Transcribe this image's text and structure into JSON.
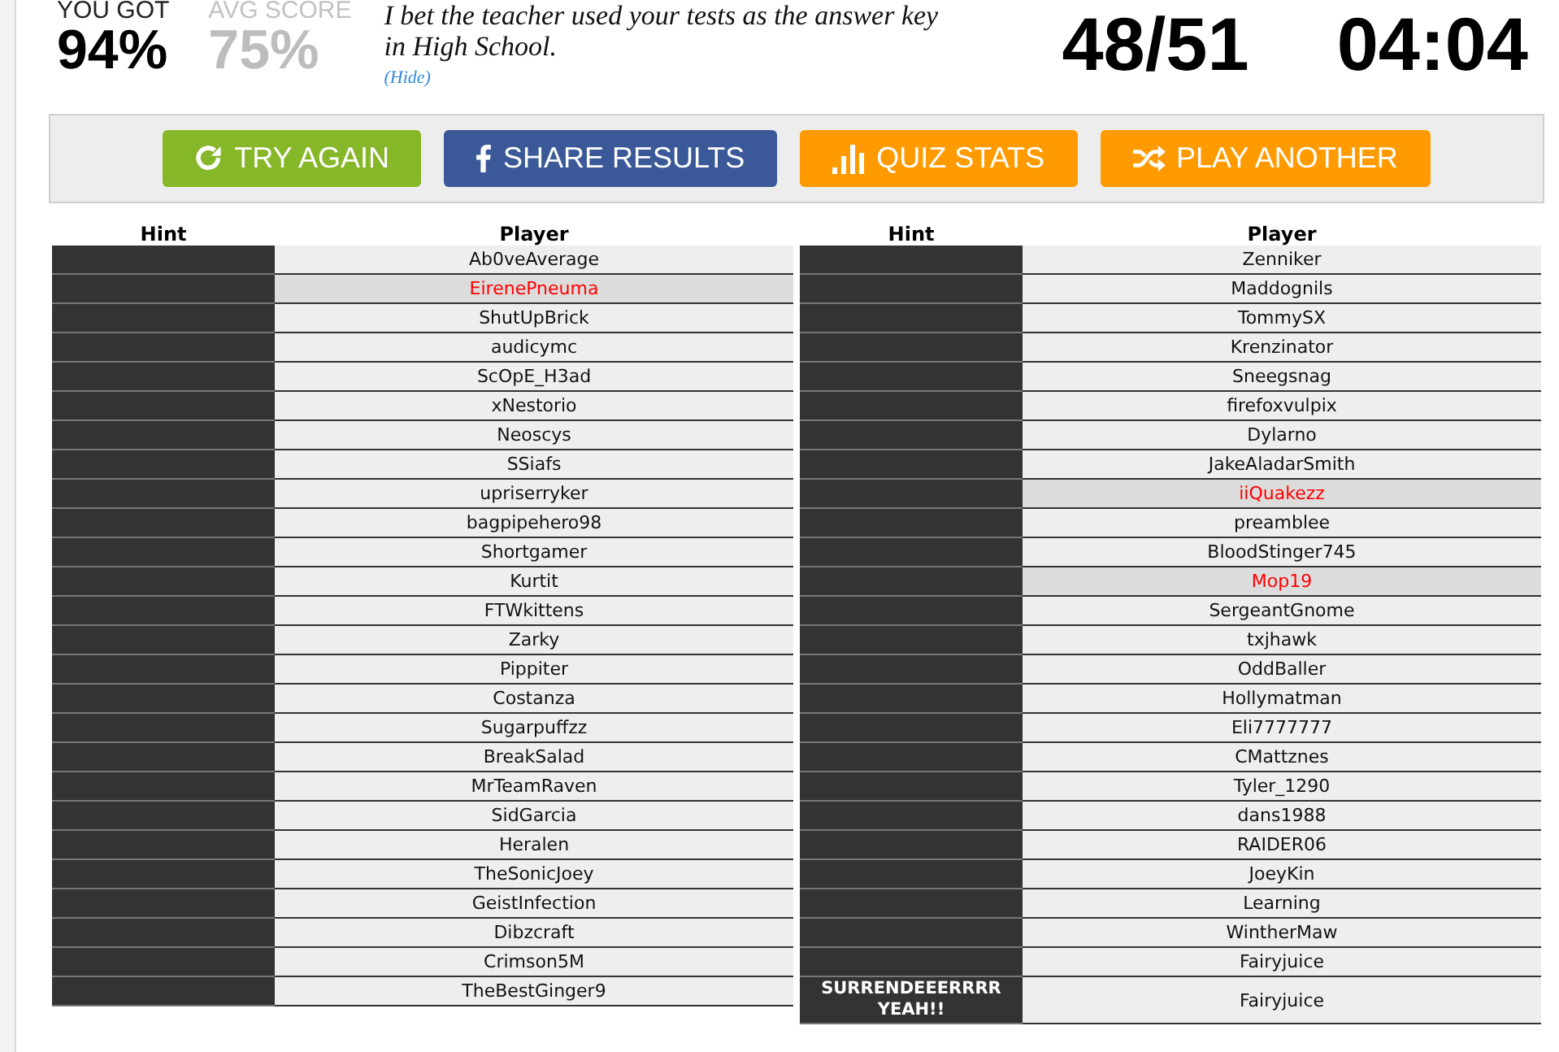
{
  "score": {
    "label": "YOU GOT",
    "value": "94%"
  },
  "average": {
    "label": "AVG SCORE",
    "value": "75%"
  },
  "message": {
    "text": "I bet the teacher used your tests as the answer key in High School.",
    "hide_link": "(Hide)"
  },
  "progress": "48/51",
  "timer": "04:04",
  "buttons": [
    {
      "kind": "retry",
      "label": "TRY AGAIN"
    },
    {
      "kind": "share",
      "label": "SHARE RESULTS"
    },
    {
      "kind": "stats",
      "label": "QUIZ STATS"
    },
    {
      "kind": "random",
      "label": "PLAY ANOTHER"
    }
  ],
  "tables": [
    {
      "columns": [
        "Hint",
        "Player"
      ],
      "rows": [
        {
          "player": "Ab0veAverage",
          "missed": false
        },
        {
          "player": "EirenePneuma",
          "missed": true
        },
        {
          "player": "ShutUpBrick",
          "missed": false
        },
        {
          "player": "audicymc",
          "missed": false
        },
        {
          "player": "ScOpE_H3ad",
          "missed": false
        },
        {
          "player": "xNestorio",
          "missed": false
        },
        {
          "player": "Neoscys",
          "missed": false
        },
        {
          "player": "SSiafs",
          "missed": false
        },
        {
          "player": "upriserryker",
          "missed": false
        },
        {
          "player": "bagpipehero98",
          "missed": false
        },
        {
          "player": "Shortgamer",
          "missed": false
        },
        {
          "player": "Kurtit",
          "missed": false
        },
        {
          "player": "FTWkittens",
          "missed": false
        },
        {
          "player": "Zarky",
          "missed": false
        },
        {
          "player": "Pippiter",
          "missed": false
        },
        {
          "player": "Costanza",
          "missed": false
        },
        {
          "player": "Sugarpuffzz",
          "missed": false
        },
        {
          "player": "BreakSalad",
          "missed": false
        },
        {
          "player": "MrTeamRaven",
          "missed": false
        },
        {
          "player": "SidGarcia",
          "missed": false
        },
        {
          "player": "Heralen",
          "missed": false
        },
        {
          "player": "TheSonicJoey",
          "missed": false
        },
        {
          "player": "GeistInfection",
          "missed": false
        },
        {
          "player": "Dibzcraft",
          "missed": false
        },
        {
          "player": "Crimson5M",
          "missed": false
        },
        {
          "player": "TheBestGinger9",
          "missed": false
        }
      ]
    },
    {
      "columns": [
        "Hint",
        "Player"
      ],
      "rows": [
        {
          "player": "Zenniker",
          "missed": false
        },
        {
          "player": "Maddognils",
          "missed": false
        },
        {
          "player": "TommySX",
          "missed": false
        },
        {
          "player": "Krenzinator",
          "missed": false
        },
        {
          "player": "Sneegsnag",
          "missed": false
        },
        {
          "player": "firefoxvulpix",
          "missed": false
        },
        {
          "player": "Dylarno",
          "missed": false
        },
        {
          "player": "JakeAladarSmith",
          "missed": false
        },
        {
          "player": "iiQuakezz",
          "missed": true
        },
        {
          "player": "preamblee",
          "missed": false
        },
        {
          "player": "BloodStinger745",
          "missed": false
        },
        {
          "player": "Mop19",
          "missed": true
        },
        {
          "player": "SergeantGnome",
          "missed": false
        },
        {
          "player": "txjhawk",
          "missed": false
        },
        {
          "player": "OddBaller",
          "missed": false
        },
        {
          "player": "Hollymatman",
          "missed": false
        },
        {
          "player": "Eli7777777",
          "missed": false
        },
        {
          "player": "CMattznes",
          "missed": false
        },
        {
          "player": "Tyler_1290",
          "missed": false
        },
        {
          "player": "dans1988",
          "missed": false
        },
        {
          "player": "RAIDER06",
          "missed": false
        },
        {
          "player": "JoeyKin",
          "missed": false
        },
        {
          "player": "Learning",
          "missed": false
        },
        {
          "player": "WintherMaw",
          "missed": false
        },
        {
          "player": "Fairyjuice",
          "missed": false
        },
        {
          "hint": "SURRENDEEERRRR YEAH!!",
          "player": "Fairyjuice",
          "missed": false
        }
      ]
    }
  ]
}
